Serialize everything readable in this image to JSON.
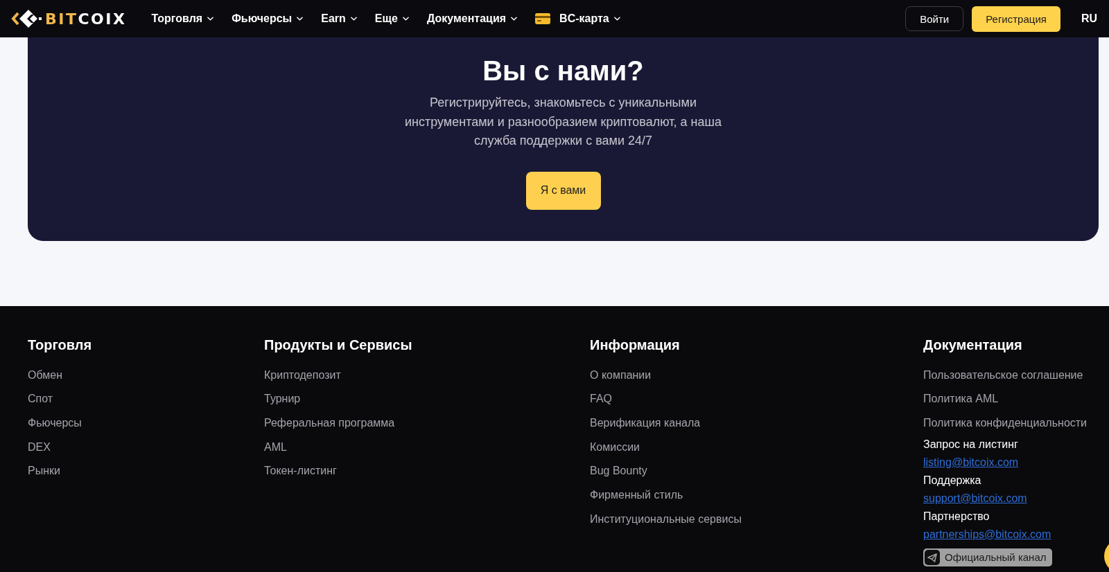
{
  "header": {
    "logo": {
      "accent": "BIT",
      "rest": "COIX"
    },
    "nav": [
      {
        "label": "Торговля",
        "kind": "menu"
      },
      {
        "label": "Фьючерсы",
        "kind": "menu"
      },
      {
        "label": "Earn",
        "kind": "menu"
      },
      {
        "label": "Еще",
        "kind": "menu"
      },
      {
        "label": "Документация",
        "kind": "menu"
      },
      {
        "label": "BC-карта",
        "kind": "card-menu"
      }
    ],
    "login_button": "Войти",
    "register_button": "Регистрация",
    "language": "RU"
  },
  "cta": {
    "title": "Вы с нами?",
    "lines": [
      "Регистрируйтесь, знакомьтесь с уникальными",
      "инструментами и разнообразием криптовалют, а наша",
      "служба поддержки с вами 24/7"
    ],
    "button": "Я с вами"
  },
  "footer": {
    "columns": [
      {
        "heading": "Торговля",
        "links": [
          "Обмен",
          "Спот",
          "Фьючерсы",
          "DEX",
          "Рынки"
        ]
      },
      {
        "heading": "Продукты и Сервисы",
        "links": [
          "Криптодепозит",
          "Турнир",
          "Реферальная программа",
          "AML",
          "Токен-листинг"
        ]
      },
      {
        "heading": "Информация",
        "links": [
          "О компании",
          "FAQ",
          "Верификация канала",
          "Комиссии",
          "Bug Bounty",
          "Фирменный стиль",
          "Институциональные сервисы"
        ]
      },
      {
        "heading": "Документация",
        "links": [
          "Пользовательское соглашение",
          "Политика AML",
          "Политика конфиденциальности"
        ],
        "contacts": [
          {
            "label": "Запрос на листинг",
            "email": "listing@bitcoix.com"
          },
          {
            "label": "Поддержка",
            "email": "support@bitcoix.com"
          },
          {
            "label": "Партнерство",
            "email": "partnerships@bitcoix.com"
          }
        ],
        "channel_button": "Официальный канал"
      }
    ]
  }
}
